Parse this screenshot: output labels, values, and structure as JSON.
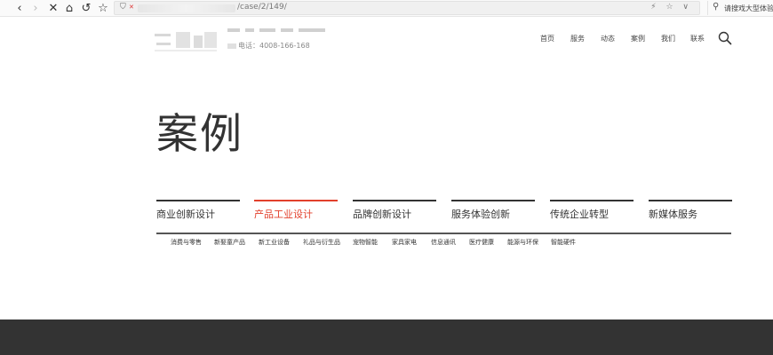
{
  "browser": {
    "url_scheme": "http://www.",
    "url_path": "/case/2/149/",
    "search_placeholder": "请搜戏大型体验馆",
    "back_icon": "‹",
    "forward_icon": "›",
    "stop_icon": "✕",
    "home_icon": "⌂",
    "reload_icon": "↺",
    "star_icon": "☆",
    "url_tools": "⚡ ☆ ∨"
  },
  "header": {
    "phone_label": "电话：",
    "phone_number": "4008-166-168",
    "nav": [
      "首页",
      "服务",
      "动态",
      "案例",
      "我们",
      "联系"
    ]
  },
  "page": {
    "title": "案例"
  },
  "tabs": [
    {
      "label": "商业创新设计",
      "active": false
    },
    {
      "label": "产品工业设计",
      "active": true
    },
    {
      "label": "品牌创新设计",
      "active": false
    },
    {
      "label": "服务体验创新",
      "active": false
    },
    {
      "label": "传统企业转型",
      "active": false
    },
    {
      "label": "新媒体服务",
      "active": false
    }
  ],
  "subcategories": [
    "消费与零售",
    "新娶童产品",
    "新工业设备",
    "礼品与衍生品",
    "宠物智能",
    "家具家电",
    "信息通讯",
    "医疗健康",
    "能源与环保",
    "智能硬件"
  ],
  "colors": {
    "accent": "#e2402c",
    "footer": "#333333"
  }
}
